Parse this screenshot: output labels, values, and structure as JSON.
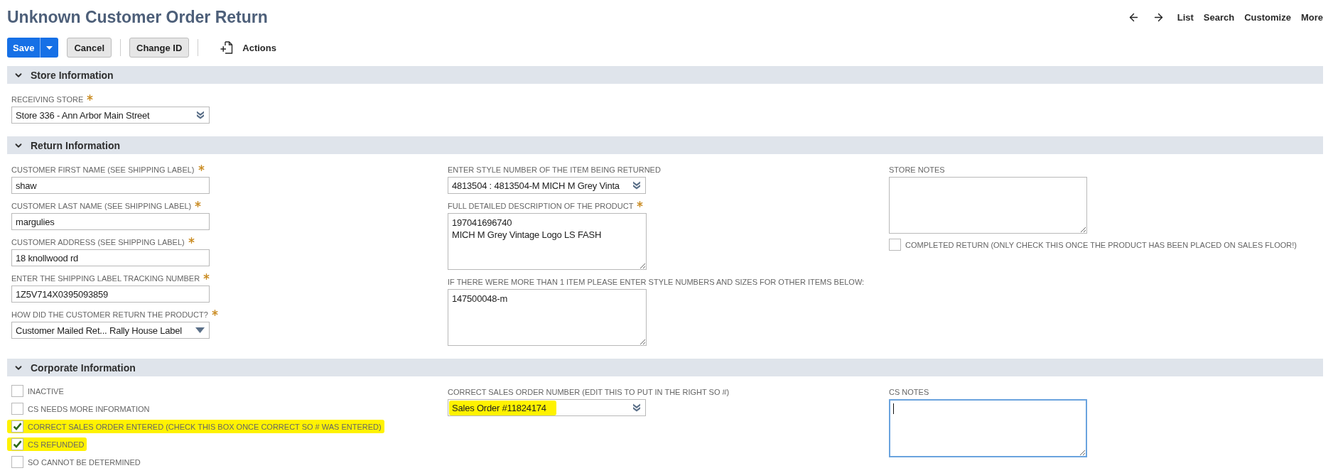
{
  "title": "Unknown Customer Order Return",
  "toolbar": [
    {
      "kind": "split",
      "label": "Save"
    },
    {
      "kind": "plain",
      "label": "Cancel"
    },
    {
      "kind": "plain",
      "label": "Change ID"
    },
    {
      "kind": "menu",
      "label": "Actions"
    }
  ],
  "nav": [
    "List",
    "Search",
    "Customize",
    "More"
  ],
  "sections": [
    {
      "title": "Store Information",
      "expanded": true,
      "columns": [
        [
          {
            "kind": "popup",
            "label": "RECEIVING STORE",
            "required": true,
            "value": "Store 336 - Ann Arbor Main Street"
          }
        ]
      ]
    },
    {
      "title": "Return Information",
      "expanded": true,
      "columns": [
        [
          {
            "kind": "text",
            "label": "CUSTOMER FIRST NAME (SEE SHIPPING LABEL)",
            "required": true,
            "value": "shaw"
          },
          {
            "kind": "text",
            "label": "CUSTOMER LAST NAME (SEE SHIPPING LABEL)",
            "required": true,
            "value": "margulies"
          },
          {
            "kind": "text",
            "label": "CUSTOMER ADDRESS (SEE SHIPPING LABEL)",
            "required": true,
            "value": "18 knollwood rd"
          },
          {
            "kind": "text",
            "label": "ENTER THE SHIPPING LABEL TRACKING NUMBER",
            "required": true,
            "value": "1Z5V714X0395093859"
          },
          {
            "kind": "dropdown",
            "label": "HOW DID THE CUSTOMER RETURN THE PRODUCT?",
            "required": true,
            "value": "Customer Mailed Ret... Rally House Label"
          }
        ],
        [
          {
            "kind": "popup",
            "label": "ENTER STYLE NUMBER OF THE ITEM BEING RETURNED",
            "required": false,
            "value": "4813504 : 4813504-M MICH M Grey Vinta"
          },
          {
            "kind": "textarea",
            "label": "FULL DETAILED DESCRIPTION OF THE PRODUCT",
            "required": true,
            "focused": false,
            "value": "197041696740\nMICH M Grey Vintage Logo LS FASH"
          },
          {
            "kind": "textarea",
            "label": "IF THERE WERE MORE THAN 1 ITEM PLEASE ENTER STYLE NUMBERS AND SIZES FOR OTHER ITEMS BELOW:",
            "required": false,
            "focused": false,
            "value": "147500048-m"
          }
        ],
        [
          {
            "kind": "textarea",
            "label": "STORE NOTES",
            "required": false,
            "focused": false
          },
          {
            "kind": "checkbox",
            "label": "COMPLETED RETURN (ONLY CHECK THIS ONCE THE PRODUCT HAS BEEN PLACED ON SALES FLOOR!)",
            "checked": false
          }
        ]
      ]
    },
    {
      "title": "Corporate Information",
      "expanded": true,
      "columns": [
        [
          {
            "kind": "checkbox",
            "label": "INACTIVE",
            "checked": false,
            "highlighted": false
          },
          {
            "kind": "checkbox",
            "label": "CS NEEDS MORE INFORMATION",
            "checked": false,
            "highlighted": false
          },
          {
            "kind": "checkbox",
            "label": "CORRECT SALES ORDER ENTERED (CHECK THIS BOX ONCE CORRECT SO # WAS ENTERED)",
            "checked": true,
            "highlighted": true
          },
          {
            "kind": "checkbox",
            "label": "CS REFUNDED",
            "checked": true,
            "highlighted": true
          },
          {
            "kind": "checkbox",
            "label": "SO CANNOT BE DETERMINED",
            "checked": false,
            "highlighted": false
          }
        ],
        [
          {
            "kind": "popup",
            "label": "CORRECT SALES ORDER NUMBER (EDIT THIS TO PUT IN THE RIGHT SO #)",
            "required": false,
            "highlighted": true,
            "value": "Sales Order #11824174"
          }
        ],
        [
          {
            "kind": "textarea",
            "label": "CS NOTES",
            "required": false,
            "focused": true
          }
        ]
      ]
    }
  ]
}
